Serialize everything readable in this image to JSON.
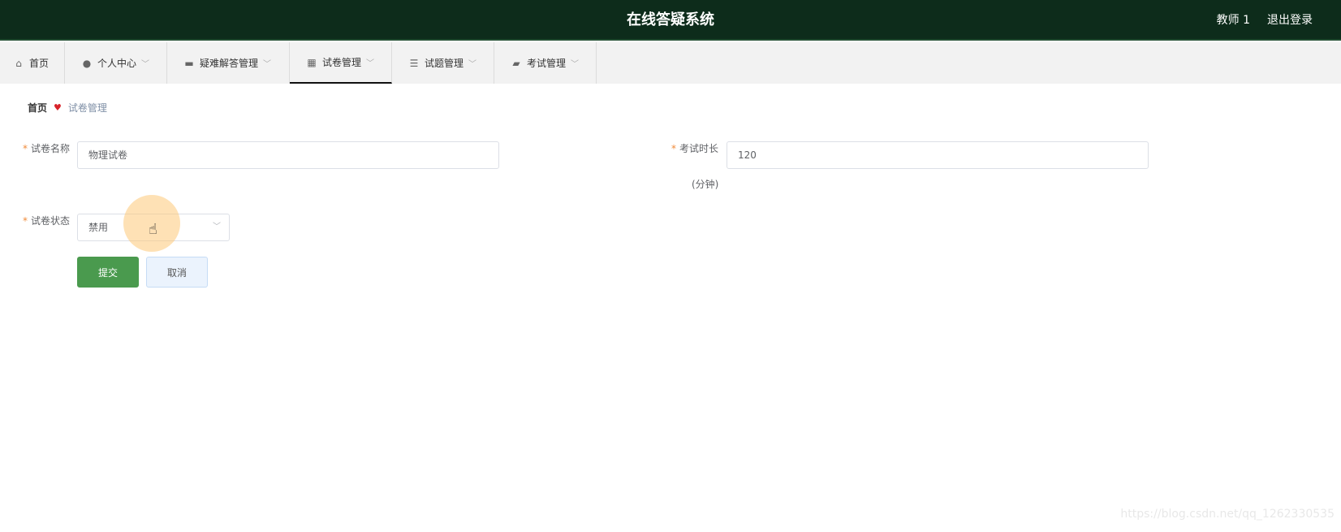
{
  "header": {
    "title": "在线答疑系统",
    "user": "教师 1",
    "logout": "退出登录",
    "bg_color": "#0d2c1b"
  },
  "nav": {
    "items": [
      {
        "label": "首页",
        "icon": "home-icon"
      },
      {
        "label": "个人中心",
        "icon": "user-icon"
      },
      {
        "label": "疑难解答管理",
        "icon": "ticket-icon"
      },
      {
        "label": "试卷管理",
        "icon": "grid-icon",
        "active": true
      },
      {
        "label": "试题管理",
        "icon": "list-icon"
      },
      {
        "label": "考试管理",
        "icon": "briefcase-icon"
      }
    ]
  },
  "breadcrumb": {
    "home": "首页",
    "current": "试卷管理"
  },
  "form": {
    "paper_name_label": "试卷名称",
    "paper_name_value": "物理试卷",
    "duration_label": "考试时长",
    "duration_unit": "(分钟)",
    "duration_value": "120",
    "status_label": "试卷状态",
    "status_value": "禁用",
    "submit_label": "提交",
    "cancel_label": "取消"
  },
  "watermark": "https://blog.csdn.net/qq_1262330535",
  "colors": {
    "accent_green": "#4a9a4e",
    "required_star": "#f08b3a"
  }
}
